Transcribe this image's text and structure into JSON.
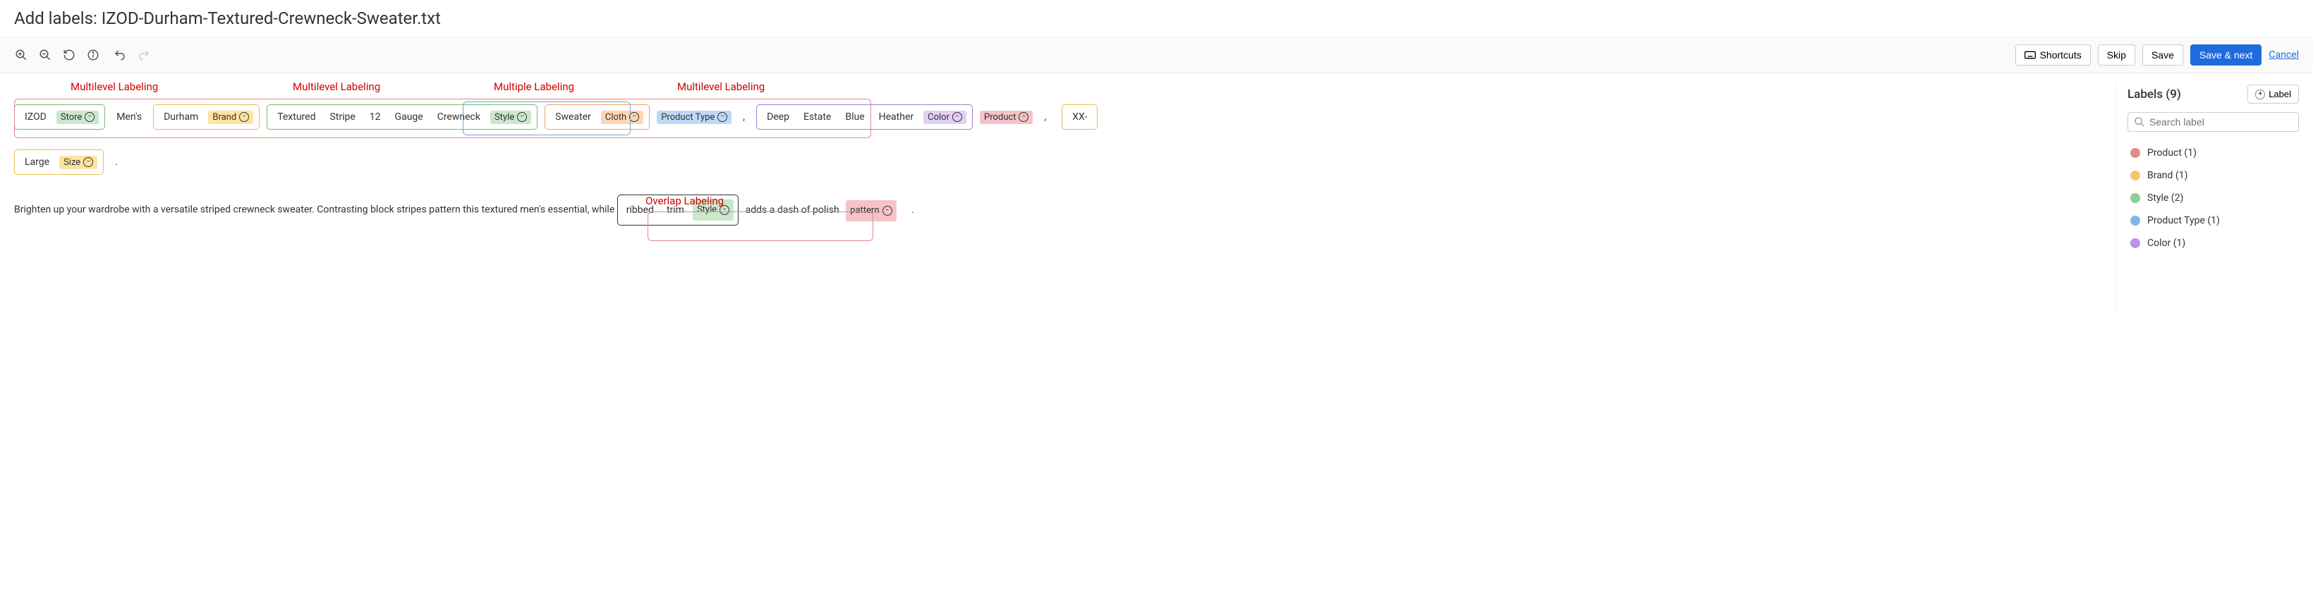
{
  "title": "Add labels: IZOD-Durham-Textured-Crewneck-Sweater.txt",
  "toolbar": {
    "shortcuts": "Shortcuts",
    "skip": "Skip",
    "save": "Save",
    "save_next": "Save & next",
    "cancel": "Cancel"
  },
  "callouts": {
    "ml1": "Multilevel Labeling",
    "ml2": "Multilevel Labeling",
    "multiple": "Multiple Labeling",
    "ml3": "Multilevel Labeling",
    "overlap": "Overlap Labeling"
  },
  "tokens": {
    "izod": "IZOD",
    "mens": "Men's",
    "durham": "Durham",
    "textured": "Textured",
    "stripe": "Stripe",
    "twelve": "12",
    "gauge": "Gauge",
    "crewneck": "Crewneck",
    "sweater": "Sweater",
    "comma1": ",",
    "deep": "Deep",
    "estate": "Estate",
    "blue": "Blue",
    "heather": "Heather",
    "comma2": ",",
    "xx": "XX-",
    "large": "Large",
    "period1": ".",
    "ribbed": "ribbed",
    "trim": "trim",
    "polish": "adds a dash of polish",
    "period2": "."
  },
  "tags": {
    "store": "Store",
    "brand": "Brand",
    "style": "Style",
    "cloth": "Cloth",
    "ptype": "Product Type",
    "color": "Color",
    "product": "Product",
    "size": "Size",
    "pattern": "pattern"
  },
  "paragraph": "Brighten up your wardrobe with a versatile striped crewneck sweater. Contrasting block stripes pattern this textured men's essential, while ",
  "sidebar": {
    "title": "Labels (9)",
    "add": "Label",
    "search_placeholder": "Search label",
    "items": [
      {
        "label": "Product (1)",
        "cls": "d-product"
      },
      {
        "label": "Brand (1)",
        "cls": "d-brand"
      },
      {
        "label": "Style (2)",
        "cls": "d-style"
      },
      {
        "label": "Product Type (1)",
        "cls": "d-ptype"
      },
      {
        "label": "Color (1)",
        "cls": "d-color"
      }
    ]
  }
}
